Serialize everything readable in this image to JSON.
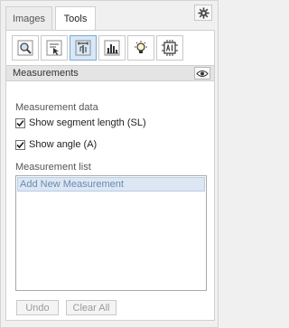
{
  "tabs": [
    {
      "label": "Images",
      "selected": false
    },
    {
      "label": "Tools",
      "selected": true
    }
  ],
  "toolbar": {
    "tools": [
      {
        "icon": "magnifier-icon",
        "selected": false
      },
      {
        "icon": "select-tool-icon",
        "selected": false
      },
      {
        "icon": "measure-tool-icon",
        "selected": true
      },
      {
        "icon": "histogram-icon",
        "selected": false
      },
      {
        "icon": "lightbulb-icon",
        "selected": false
      },
      {
        "icon": "ai-chip-icon",
        "selected": false
      }
    ]
  },
  "section": {
    "title": "Measurements"
  },
  "measurement_data": {
    "label": "Measurement data",
    "options": [
      {
        "label": "Show segment length (SL)",
        "checked": true
      },
      {
        "label": "Show angle (A)",
        "checked": true
      }
    ]
  },
  "measurement_list": {
    "label": "Measurement list",
    "items": [
      "Add New Measurement"
    ]
  },
  "footer": {
    "undo_label": "Undo",
    "clear_label": "Clear All"
  },
  "colors": {
    "accent": "#7fa8d3",
    "selected_bg": "#d9e8f6",
    "list_item_bg": "#dce7f3"
  }
}
